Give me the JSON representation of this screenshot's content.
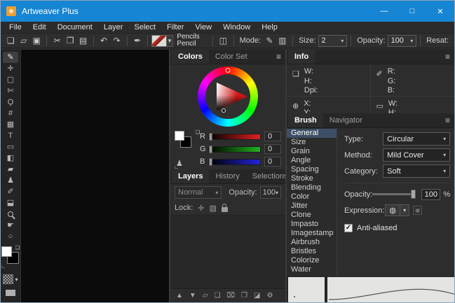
{
  "window": {
    "title": "Artweaver Plus"
  },
  "menubar": {
    "items": [
      "File",
      "Edit",
      "Document",
      "Layer",
      "Select",
      "Filter",
      "View",
      "Window",
      "Help"
    ]
  },
  "toolbar": {
    "brush_name": "Pencils",
    "brush_variant": "Pencil",
    "mode_label": "Mode:",
    "size_label": "Size:",
    "size_value": "2",
    "opacity_label": "Opacity:",
    "opacity_value": "100",
    "resat_label": "Resat:"
  },
  "colors_panel": {
    "tab_colors": "Colors",
    "tab_color_set": "Color Set",
    "sliders": [
      {
        "label": "R",
        "value": "0"
      },
      {
        "label": "G",
        "value": "0"
      },
      {
        "label": "B",
        "value": "0"
      }
    ]
  },
  "layers_panel": {
    "tab_layers": "Layers",
    "tab_history": "History",
    "tab_selections": "Selections",
    "blend_mode": "Normal",
    "opacity_label": "Opacity:",
    "opacity_value": "100",
    "lock_label": "Lock:"
  },
  "info_panel": {
    "title": "Info",
    "doc_w": "W:",
    "doc_h": "H:",
    "doc_dpi": "Dpi:",
    "col_r": "R:",
    "col_g": "G:",
    "col_b": "B:",
    "pos_x": "X:",
    "pos_y": "Y:",
    "sel_w": "W:",
    "sel_h": "H:"
  },
  "brush_panel": {
    "tab_brush": "Brush",
    "tab_navigator": "Navigator",
    "categories": [
      "General",
      "Size",
      "Grain",
      "Angle",
      "Spacing",
      "Stroke",
      "Blending",
      "Color",
      "Jitter",
      "Clone",
      "Impasto",
      "Imagestamp",
      "Airbrush",
      "Bristles",
      "Colorize",
      "Water"
    ],
    "selected_category": "General",
    "type_label": "Type:",
    "type_value": "Circular",
    "method_label": "Method:",
    "method_value": "Mild Cover",
    "category_label": "Category:",
    "category_value": "Soft",
    "opacity_label": "Opacity:",
    "opacity_value": "100",
    "opacity_unit": "%",
    "expression_label": "Expression:",
    "antialiased_label": "Anti-aliased",
    "antialiased_checked": true
  },
  "colors": {
    "titlebar_blue": "#1685d3",
    "selection_blue": "#3c4f66",
    "slider_red": "#e02020",
    "slider_green": "#1eb41e",
    "slider_blue": "#2222dd",
    "panel_bg": "#2d2d2d",
    "canvas_bg": "#0b0b0b"
  },
  "icons": {
    "app": "❀",
    "minimize": "—",
    "maximize": "□",
    "close": "✕",
    "new_document": "❏",
    "open_folder": "▱",
    "save": "▣",
    "cut": "✂",
    "copy": "❐",
    "paste": "▤",
    "undo": "↶",
    "redo": "↷",
    "pen": "✒",
    "chevron_down": "▾",
    "panel_toggle": "◫",
    "mode_freehand": "✎",
    "mode_straight": "▥",
    "panel_menu": "≡",
    "tool_brush": "✎",
    "tool_move": "✛",
    "tool_select": "▢",
    "tool_slice": "✄",
    "tool_lasso": "Ϙ",
    "tool_crop": "#",
    "tool_mosaic": "▦",
    "tool_text": "T",
    "tool_shape": "▭",
    "tool_gradient": "◧",
    "tool_eraser": "▰",
    "tool_clone": "♟",
    "tool_eyedropper": "✐",
    "tool_fill": "⬓",
    "tool_hand": "☛",
    "tool_rotate": "○",
    "default_colors": "❏",
    "swap_colors": "∟",
    "stamp": "♟",
    "layer_up": "▲",
    "layer_down": "▼",
    "layer_group": "▱",
    "layer_new": "❏",
    "layer_delete": "⌧",
    "layer_duplicate": "❐",
    "layer_adjust": "◪",
    "layer_settings": "⚙",
    "info_document": "❏",
    "info_eyedropper": "✐",
    "info_position": "⊕",
    "info_selection": "▭",
    "lock_position": "✛",
    "lock_pixels": "▨",
    "expression": "◍",
    "expression_edit": "▣",
    "check": "✓"
  }
}
